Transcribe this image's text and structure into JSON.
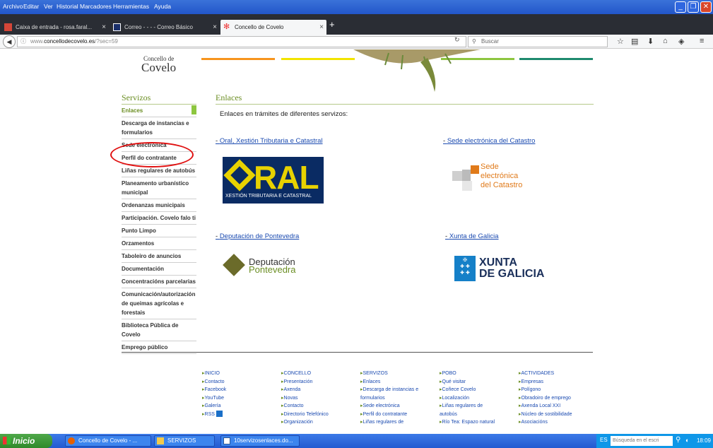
{
  "menubar": {
    "items": [
      "Archivo",
      "Editar",
      "Ver",
      "Historial",
      "Marcadores",
      "Herramientas",
      "Ayuda"
    ]
  },
  "tabs": [
    {
      "label": "Caixa de entrada - rosa.faral...",
      "icon": "gmail-icon"
    },
    {
      "label": "Correo - - - - Correo Básico",
      "icon": "mail-icon"
    },
    {
      "label": "Concello de Covelo",
      "icon": "site-icon",
      "active": true
    }
  ],
  "navbar": {
    "url_prefix": "www.",
    "url_domain": "concellodecovelo.es",
    "url_rest": "/?sec=59",
    "search_placeholder": "Buscar"
  },
  "header": {
    "logo_small": "Concello de",
    "logo_big": "Covelo",
    "bar_colors": [
      "#f7941d",
      "#f2e400",
      "#8dc63f",
      "#1e8a6e"
    ]
  },
  "sidebar": {
    "title": "Servizos",
    "items": [
      {
        "label": "Enlaces",
        "active": true
      },
      {
        "label": "Descarga de instancias e formularios"
      },
      {
        "label": "Sede electrónica"
      },
      {
        "label": "Perfil do contratante"
      },
      {
        "label": "Liñas regulares de autobús"
      },
      {
        "label": "Planeamento urbanístico municipal"
      },
      {
        "label": "Ordenanzas municipais"
      },
      {
        "label": "Participación. Covelo falo ti"
      },
      {
        "label": "Punto Limpo"
      },
      {
        "label": "Orzamentos"
      },
      {
        "label": "Taboleiro de anuncios"
      },
      {
        "label": "Documentación"
      },
      {
        "label": "Concentracións parcelarias"
      },
      {
        "label": "Comunicación/autorización de queimas agrícolas e forestais"
      },
      {
        "label": "Biblioteca Pública de Covelo"
      },
      {
        "label": "Emprego público"
      }
    ]
  },
  "main": {
    "title": "Enlaces",
    "intro": "Enlaces en trámites de diferentes servizos:",
    "links": [
      {
        "label": "Oral, Xestión Tributaria e Catastral"
      },
      {
        "label": "Sede electrónica del Catastro"
      },
      {
        "label": "Deputación de Pontevedra"
      },
      {
        "label": "Xunta de Galicia"
      }
    ],
    "oral_logo": {
      "word": "RAL",
      "sub": "XESTIÓN TRIBUTARIA E CATASTRAL"
    },
    "catastro_logo": {
      "line1": "Sede",
      "line2": "electrónica",
      "line3": "del Catastro"
    },
    "deputacion_logo": {
      "line1": "Deputación",
      "line2": "Pontevedra"
    },
    "xunta_logo": {
      "line1": "XUNTA",
      "line2": "DE GALICIA"
    }
  },
  "footer": {
    "columns": [
      {
        "heading": "INICIO",
        "items": [
          "Contacto",
          "Facebook",
          "YouTube",
          "Galería",
          "RSS"
        ]
      },
      {
        "heading": "CONCELLO",
        "items": [
          "Presentación",
          "Axenda",
          "Novas",
          "Contacto",
          "Directorio Telefónico",
          "Organización"
        ]
      },
      {
        "heading": "SERVIZOS",
        "items": [
          "Enlaces",
          "Descarga de instancias e",
          "formularios",
          "Sede electrónica",
          "Perfil do contratante",
          "Liñas regulares de"
        ]
      },
      {
        "heading": "POBO",
        "items": [
          "Qué visitar",
          "Coñece Covelo",
          "Localización",
          "Liñas regulares de",
          "autobús",
          "Río Tea: Espazo natural"
        ]
      },
      {
        "heading": "ACTIVIDADES",
        "items": [
          "Empresas",
          "Polígono",
          "Obradoiro de emprego",
          "Axenda Local XXI",
          "Núcleo de sostibilidade",
          "Asociacións"
        ]
      }
    ]
  },
  "taskbar": {
    "start": "Inicio",
    "items": [
      "Concello de Covelo - ...",
      "SERVIZOS",
      "10servizosenlaces.do..."
    ],
    "lang": "ES",
    "search_placeholder": "Búsqueda en el escri",
    "time": "18:09"
  }
}
